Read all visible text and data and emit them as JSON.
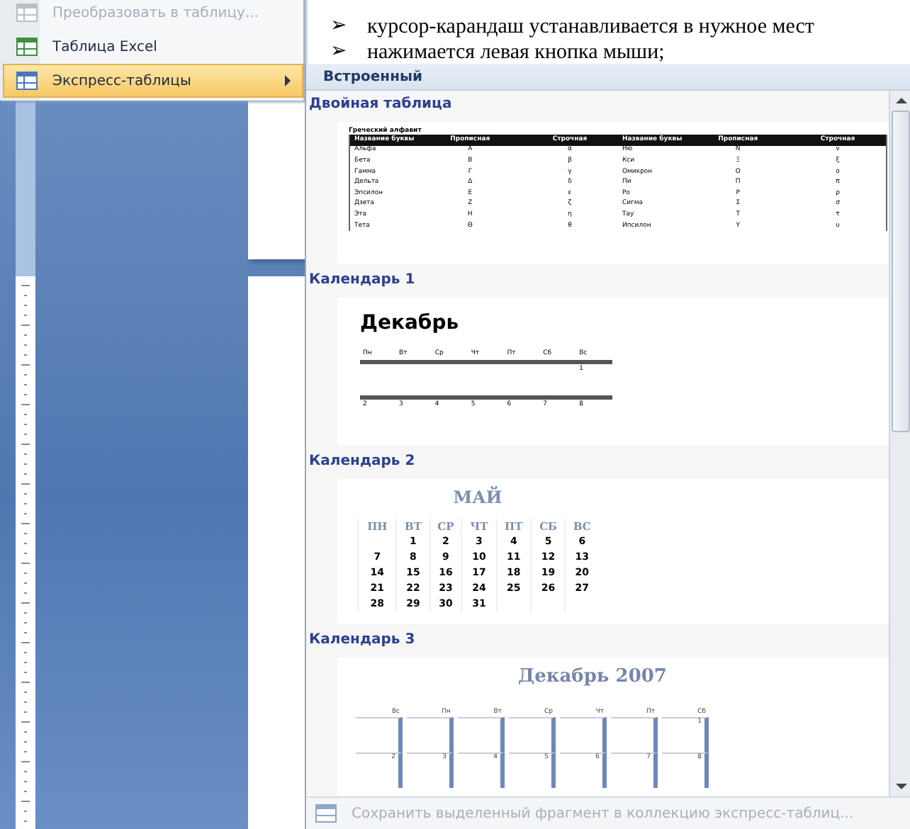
{
  "document": {
    "bullets": [
      {
        "marker": "➢",
        "text": "курсор-карандаш устанавливается в нужное мест"
      },
      {
        "marker": "➢",
        "text": "нажимается левая кнопка мыши;"
      }
    ]
  },
  "menu": {
    "items": [
      {
        "label": "Преобразовать в таблицу...",
        "kind": "table",
        "disabled": true,
        "selected": false,
        "submenu": false
      },
      {
        "label": "Таблица Excel",
        "kind": "spreadsheet",
        "disabled": false,
        "selected": false,
        "submenu": false
      },
      {
        "label": "Экспресс-таблицы",
        "kind": "table",
        "disabled": false,
        "selected": true,
        "submenu": true
      }
    ]
  },
  "gallery": {
    "header": "Встроенный",
    "items": [
      {
        "kind": "double-table",
        "title": "Двойная таблица",
        "caption": "Греческий алфавит",
        "columns": [
          "Название буквы",
          "Прописная",
          "Строчная",
          "Название буквы",
          "Прописная",
          "Строчная"
        ],
        "rows": [
          [
            "Альфа",
            "Α",
            "α",
            "Ню",
            "Ν",
            "ν"
          ],
          [
            "Бета",
            "Β",
            "β",
            "Кси",
            "Ξ",
            "ξ"
          ],
          [
            "Гамма",
            "Γ",
            "γ",
            "Омикрон",
            "Ο",
            "ο"
          ],
          [
            "Дельта",
            "Δ",
            "δ",
            "Пи",
            "Π",
            "π"
          ],
          [
            "Эпсилон",
            "Ε",
            "ε",
            "Ро",
            "Ρ",
            "ρ"
          ],
          [
            "Дзета",
            "Ζ",
            "ζ",
            "Сигма",
            "Σ",
            "σ"
          ],
          [
            "Эта",
            "Η",
            "η",
            "Тау",
            "Τ",
            "τ"
          ],
          [
            "Тета",
            "Θ",
            "θ",
            "Ипсилон",
            "Υ",
            "υ"
          ]
        ]
      },
      {
        "kind": "calendar-lined",
        "title": "Календарь 1",
        "month": "Декабрь",
        "days": [
          "Пн",
          "Вт",
          "Ср",
          "Чт",
          "Пт",
          "Сб",
          "Вс"
        ],
        "weeks": [
          [
            {
              "kind": "empty"
            },
            {
              "kind": "empty"
            },
            {
              "kind": "empty"
            },
            {
              "kind": "empty"
            },
            {
              "kind": "empty"
            },
            {
              "kind": "empty"
            },
            {
              "kind": "date",
              "date": "1"
            }
          ],
          [
            {
              "kind": "date",
              "date": "2"
            },
            {
              "kind": "date",
              "date": "3"
            },
            {
              "kind": "date",
              "date": "4"
            },
            {
              "kind": "date",
              "date": "5"
            },
            {
              "kind": "date",
              "date": "6"
            },
            {
              "kind": "date",
              "date": "7"
            },
            {
              "kind": "date",
              "date": "8"
            }
          ]
        ]
      },
      {
        "kind": "calendar-grid",
        "title": "Календарь 2",
        "month": "МАЙ",
        "days": [
          "ПН",
          "ВТ",
          "СР",
          "ЧТ",
          "ПТ",
          "СБ",
          "ВС"
        ],
        "weeks": [
          [
            {
              "kind": "empty"
            },
            {
              "kind": "date",
              "date": "1"
            },
            {
              "kind": "date",
              "date": "2"
            },
            {
              "kind": "date",
              "date": "3"
            },
            {
              "kind": "date",
              "date": "4"
            },
            {
              "kind": "date",
              "date": "5"
            },
            {
              "kind": "date",
              "date": "6"
            }
          ],
          [
            {
              "kind": "date",
              "date": "7"
            },
            {
              "kind": "date",
              "date": "8"
            },
            {
              "kind": "date",
              "date": "9"
            },
            {
              "kind": "date",
              "date": "10"
            },
            {
              "kind": "date",
              "date": "11"
            },
            {
              "kind": "date",
              "date": "12"
            },
            {
              "kind": "date",
              "date": "13"
            }
          ],
          [
            {
              "kind": "date",
              "date": "14"
            },
            {
              "kind": "date",
              "date": "15"
            },
            {
              "kind": "date",
              "date": "16"
            },
            {
              "kind": "date",
              "date": "17"
            },
            {
              "kind": "date",
              "date": "18"
            },
            {
              "kind": "date",
              "date": "19"
            },
            {
              "kind": "date",
              "date": "20"
            }
          ],
          [
            {
              "kind": "date",
              "date": "21"
            },
            {
              "kind": "date",
              "date": "22"
            },
            {
              "kind": "date",
              "date": "23"
            },
            {
              "kind": "date",
              "date": "24"
            },
            {
              "kind": "date",
              "date": "25"
            },
            {
              "kind": "date",
              "date": "26"
            },
            {
              "kind": "date",
              "date": "27"
            }
          ],
          [
            {
              "kind": "date",
              "date": "28"
            },
            {
              "kind": "date",
              "date": "29"
            },
            {
              "kind": "date",
              "date": "30"
            },
            {
              "kind": "date",
              "date": "31"
            },
            {
              "kind": "empty"
            },
            {
              "kind": "empty"
            },
            {
              "kind": "empty"
            }
          ]
        ]
      },
      {
        "kind": "calendar-boxed",
        "title": "Календарь 3",
        "month": "Декабрь 2007",
        "days": [
          "Вс",
          "Пн",
          "Вт",
          "Ср",
          "Чт",
          "Пт",
          "Сб"
        ],
        "weeks": [
          [
            {
              "kind": "empty"
            },
            {
              "kind": "empty"
            },
            {
              "kind": "empty"
            },
            {
              "kind": "empty"
            },
            {
              "kind": "empty"
            },
            {
              "kind": "empty"
            },
            {
              "kind": "date",
              "date": "1"
            }
          ],
          [
            {
              "kind": "date",
              "date": "2"
            },
            {
              "kind": "date",
              "date": "3"
            },
            {
              "kind": "date",
              "date": "4"
            },
            {
              "kind": "date",
              "date": "5"
            },
            {
              "kind": "date",
              "date": "6"
            },
            {
              "kind": "date",
              "date": "7"
            },
            {
              "kind": "date",
              "date": "8"
            }
          ]
        ]
      }
    ],
    "footer": {
      "label": "Сохранить выделенный фрагмент в коллекцию экспресс-таблиц...",
      "disabled": true
    }
  }
}
